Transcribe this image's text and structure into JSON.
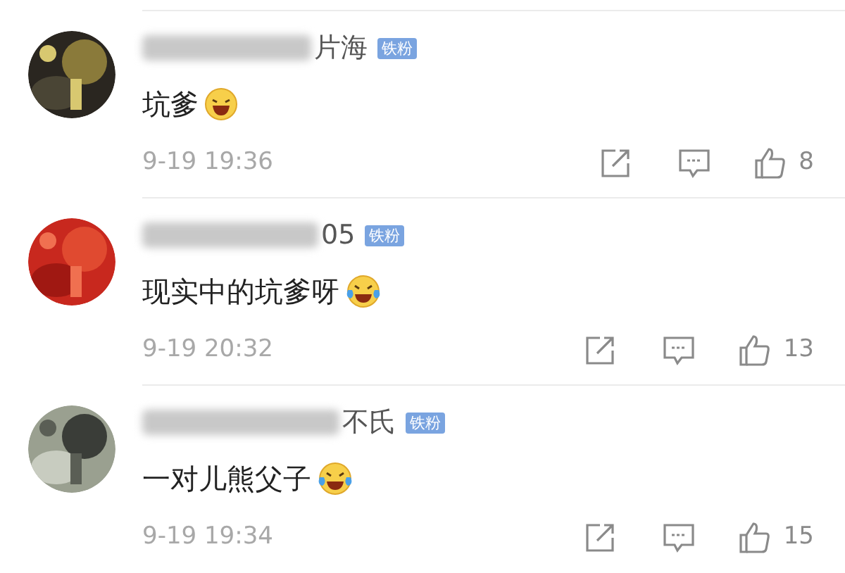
{
  "comments": [
    {
      "name_visible": "片海",
      "badge": "铁粉",
      "text": "坑爹",
      "emoji": {
        "kind": "laugh"
      },
      "time": "9-19 19:36",
      "likes": "8"
    },
    {
      "name_visible": "05",
      "badge": "铁粉",
      "text": "现实中的坑爹呀",
      "emoji": {
        "kind": "cry"
      },
      "time": "9-19 20:32",
      "likes": "13"
    },
    {
      "name_visible": "不氏",
      "badge": "铁粉",
      "text": "一对儿熊父子",
      "emoji": {
        "kind": "cry"
      },
      "time": "9-19 19:34",
      "likes": "15"
    }
  ]
}
